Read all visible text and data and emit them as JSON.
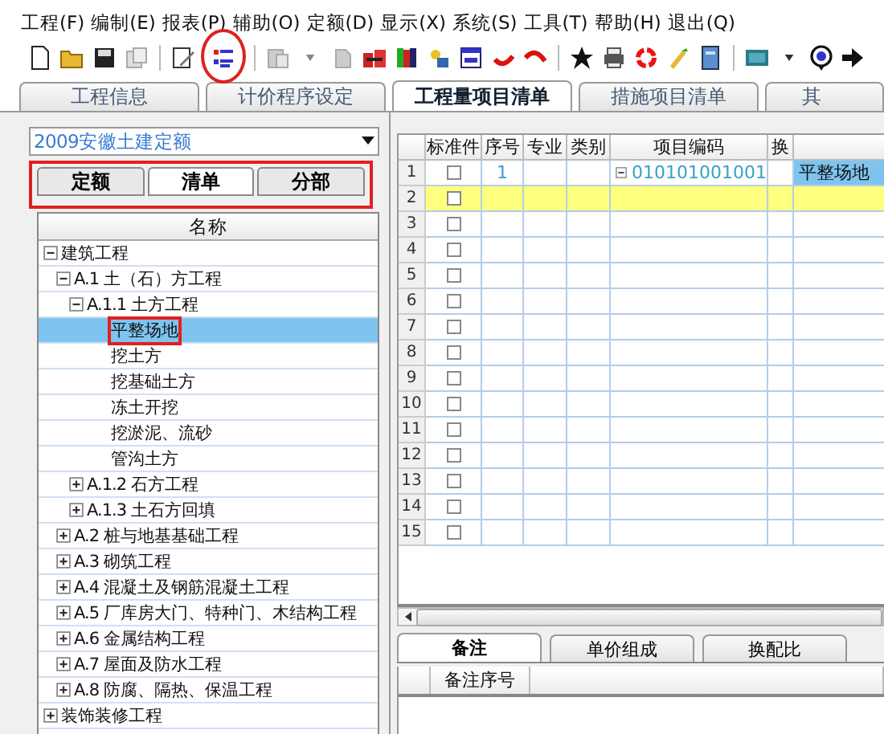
{
  "menu": [
    "工程(F)",
    "编制(E)",
    "报表(P)",
    "辅助(O)",
    "定额(D)",
    "显示(X)",
    "系统(S)",
    "工具(T)",
    "帮助(H)",
    "退出(Q)"
  ],
  "toolbar": [
    {
      "highlighted": false
    },
    {
      "highlighted": false
    },
    {
      "highlighted": false
    },
    {
      "highlighted": false
    },
    {
      "highlighted": false
    },
    {
      "highlighted": true
    },
    {
      "highlighted": false
    },
    {
      "highlighted": false
    },
    {
      "highlighted": false
    },
    {
      "highlighted": false
    },
    {
      "highlighted": false
    },
    {
      "highlighted": false
    },
    {
      "highlighted": false
    },
    {
      "highlighted": false
    },
    {
      "highlighted": false
    },
    {
      "highlighted": false
    },
    {
      "highlighted": false
    },
    {
      "highlighted": false
    },
    {
      "highlighted": false
    },
    {
      "highlighted": false
    },
    {
      "highlighted": false
    },
    {
      "highlighted": false
    },
    {
      "highlighted": false
    },
    {
      "highlighted": false
    }
  ],
  "tabs": [
    {
      "label": "工程信息",
      "selected": false
    },
    {
      "label": "计价程序设定",
      "selected": false
    },
    {
      "label": "工程量项目清单",
      "selected": true
    },
    {
      "label": "措施项目清单",
      "selected": false
    },
    {
      "label": "其",
      "selected": false
    }
  ],
  "library": {
    "value": "2009安徽土建定额",
    "subtabs_highlighted": true,
    "subtabs": [
      {
        "label": "定额",
        "selected": false
      },
      {
        "label": "清单",
        "selected": true
      },
      {
        "label": "分部",
        "selected": false
      }
    ],
    "tree_header": "名称",
    "tree": [
      {
        "label": "建筑工程",
        "expanded": true,
        "selected": false,
        "children": [
          {
            "label": "A.1 土（石）方工程",
            "expanded": true,
            "selected": false,
            "children": [
              {
                "label": "A.1.1 土方工程",
                "expanded": true,
                "selected": false,
                "children": [
                  {
                    "label": "平整场地",
                    "selected": true,
                    "highlighted": true
                  },
                  {
                    "label": "挖土方",
                    "selected": false
                  },
                  {
                    "label": "挖基础土方",
                    "selected": false
                  },
                  {
                    "label": "冻土开挖",
                    "selected": false
                  },
                  {
                    "label": "挖淤泥、流砂",
                    "selected": false
                  },
                  {
                    "label": "管沟土方",
                    "selected": false
                  }
                ]
              },
              {
                "label": "A.1.2 石方工程",
                "expanded": false,
                "selected": false
              },
              {
                "label": "A.1.3 土石方回填",
                "expanded": false,
                "selected": false
              }
            ]
          },
          {
            "label": "A.2 桩与地基基础工程",
            "expanded": false,
            "selected": false
          },
          {
            "label": "A.3 砌筑工程",
            "expanded": false,
            "selected": false
          },
          {
            "label": "A.4 混凝土及钢筋混凝土工程",
            "expanded": false,
            "selected": false
          },
          {
            "label": "A.5 厂库房大门、特种门、木结构工程",
            "expanded": false,
            "selected": false
          },
          {
            "label": "A.6 金属结构工程",
            "expanded": false,
            "selected": false
          },
          {
            "label": "A.7 屋面及防水工程",
            "expanded": false,
            "selected": false
          },
          {
            "label": "A.8 防腐、隔热、保温工程",
            "expanded": false,
            "selected": false
          }
        ]
      },
      {
        "label": "装饰装修工程",
        "expanded": false,
        "selected": false
      }
    ]
  },
  "grid": {
    "columns": [
      "标准件",
      "序号",
      "专业",
      "类别",
      "项目编码",
      "换"
    ],
    "rows": [
      {
        "number": "1",
        "standard": false,
        "seq": "1",
        "code": "010101001001",
        "code_expanded": true,
        "name": "平整场地",
        "name_cell_selected": true,
        "selected": false
      },
      {
        "number": "2",
        "standard": false,
        "selected": true
      },
      {
        "number": "3",
        "standard": false,
        "selected": false
      },
      {
        "number": "4",
        "standard": false,
        "selected": false
      },
      {
        "number": "5",
        "standard": false,
        "selected": false
      },
      {
        "number": "6",
        "standard": false,
        "selected": false
      },
      {
        "number": "7",
        "standard": false,
        "selected": false
      },
      {
        "number": "8",
        "standard": false,
        "selected": false
      },
      {
        "number": "9",
        "standard": false,
        "selected": false
      },
      {
        "number": "10",
        "standard": false,
        "selected": false
      },
      {
        "number": "11",
        "standard": false,
        "selected": false
      },
      {
        "number": "12",
        "standard": false,
        "selected": false
      },
      {
        "number": "13",
        "standard": false,
        "selected": false
      },
      {
        "number": "14",
        "standard": false,
        "selected": false
      },
      {
        "number": "15",
        "standard": false,
        "selected": false
      }
    ]
  },
  "detail": {
    "tabs": [
      {
        "label": "备注",
        "selected": true
      },
      {
        "label": "单价组成",
        "selected": false
      },
      {
        "label": "换配比",
        "selected": false
      }
    ],
    "columns": [
      "备注序号"
    ]
  }
}
